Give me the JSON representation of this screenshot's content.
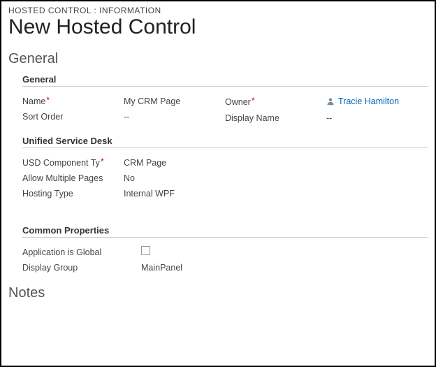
{
  "breadcrumb": "HOSTED CONTROL : INFORMATION",
  "page_title": "New Hosted Control",
  "tabs": {
    "general": "General",
    "notes": "Notes"
  },
  "sections": {
    "general": {
      "title": "General",
      "fields": {
        "name": {
          "label": "Name",
          "value": "My CRM Page",
          "required": true
        },
        "sort_order": {
          "label": "Sort Order",
          "value": "--"
        },
        "owner": {
          "label": "Owner",
          "value": "Tracie Hamilton",
          "required": true
        },
        "display_name": {
          "label": "Display Name",
          "value": "--"
        }
      }
    },
    "usd": {
      "title": "Unified Service Desk",
      "fields": {
        "component_type": {
          "label": "USD Component Ty",
          "value": "CRM Page",
          "required": true
        },
        "allow_multiple": {
          "label": "Allow Multiple Pages",
          "value": "No"
        },
        "hosting_type": {
          "label": "Hosting Type",
          "value": "Internal WPF"
        }
      }
    },
    "common": {
      "title": "Common Properties",
      "fields": {
        "app_is_global": {
          "label": "Application is Global",
          "checked": false
        },
        "display_group": {
          "label": "Display Group",
          "value": "MainPanel"
        }
      }
    }
  }
}
